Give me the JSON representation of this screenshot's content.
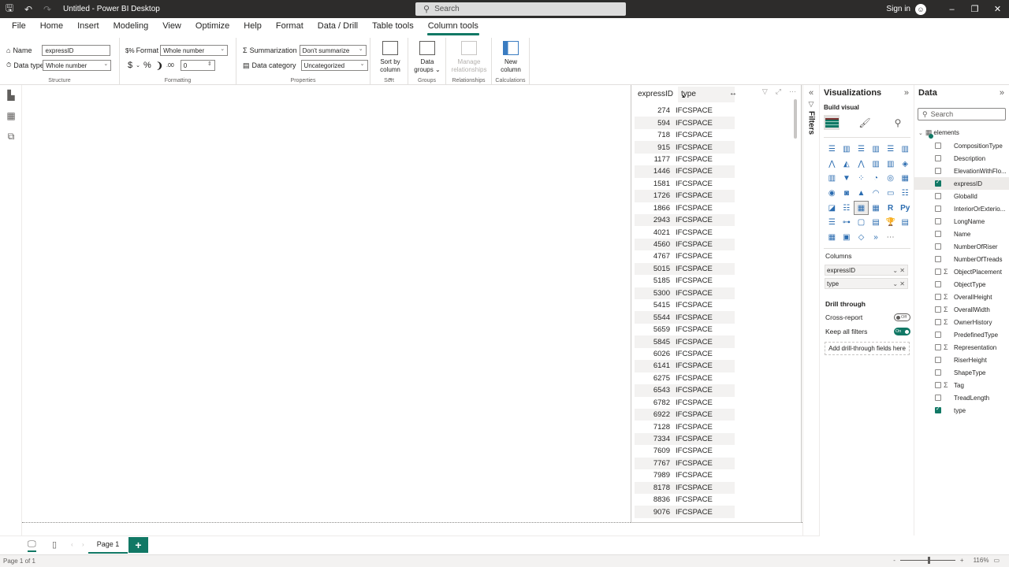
{
  "titlebar": {
    "title": "Untitled - Power BI Desktop",
    "search_placeholder": "Search",
    "sign_in": "Sign in",
    "icons": [
      "save-icon",
      "undo-icon",
      "redo-icon"
    ]
  },
  "menu": {
    "items": [
      "File",
      "Home",
      "Insert",
      "Modeling",
      "View",
      "Optimize",
      "Help",
      "Format",
      "Data / Drill",
      "Table tools",
      "Column tools"
    ],
    "active": "Column tools"
  },
  "ribbon": {
    "structure": {
      "name_label": "Name",
      "name_value": "expressID",
      "datatype_label": "Data type",
      "datatype_value": "Whole number",
      "group_label": "Structure"
    },
    "formatting": {
      "format_label": "Format",
      "format_value": "Whole number",
      "currency_symbol": "$",
      "percent_symbol": "%",
      "comma_symbol": ")",
      "decimals_value": "0",
      "group_label": "Formatting"
    },
    "properties": {
      "summarization_label": "Summarization",
      "summarization_value": "Don't summarize",
      "category_label": "Data category",
      "category_value": "Uncategorized",
      "group_label": "Properties"
    },
    "sort": {
      "label1": "Sort by",
      "label2": "column",
      "group_label": "Sort"
    },
    "groups": {
      "label1": "Data",
      "label2": "groups",
      "group_label": "Groups"
    },
    "relationships": {
      "label1": "Manage",
      "label2": "relationships",
      "group_label": "Relationships"
    },
    "calculations": {
      "label1": "New",
      "label2": "column",
      "group_label": "Calculations"
    }
  },
  "table_visual": {
    "columns": [
      "expressID",
      "type"
    ],
    "sorted_column": "type",
    "rows": [
      [
        "274",
        "IFCSPACE"
      ],
      [
        "594",
        "IFCSPACE"
      ],
      [
        "718",
        "IFCSPACE"
      ],
      [
        "915",
        "IFCSPACE"
      ],
      [
        "1177",
        "IFCSPACE"
      ],
      [
        "1446",
        "IFCSPACE"
      ],
      [
        "1581",
        "IFCSPACE"
      ],
      [
        "1726",
        "IFCSPACE"
      ],
      [
        "1866",
        "IFCSPACE"
      ],
      [
        "2943",
        "IFCSPACE"
      ],
      [
        "4021",
        "IFCSPACE"
      ],
      [
        "4560",
        "IFCSPACE"
      ],
      [
        "4767",
        "IFCSPACE"
      ],
      [
        "5015",
        "IFCSPACE"
      ],
      [
        "5185",
        "IFCSPACE"
      ],
      [
        "5300",
        "IFCSPACE"
      ],
      [
        "5415",
        "IFCSPACE"
      ],
      [
        "5544",
        "IFCSPACE"
      ],
      [
        "5659",
        "IFCSPACE"
      ],
      [
        "5845",
        "IFCSPACE"
      ],
      [
        "6026",
        "IFCSPACE"
      ],
      [
        "6141",
        "IFCSPACE"
      ],
      [
        "6275",
        "IFCSPACE"
      ],
      [
        "6543",
        "IFCSPACE"
      ],
      [
        "6782",
        "IFCSPACE"
      ],
      [
        "6922",
        "IFCSPACE"
      ],
      [
        "7128",
        "IFCSPACE"
      ],
      [
        "7334",
        "IFCSPACE"
      ],
      [
        "7609",
        "IFCSPACE"
      ],
      [
        "7767",
        "IFCSPACE"
      ],
      [
        "7989",
        "IFCSPACE"
      ],
      [
        "8178",
        "IFCSPACE"
      ],
      [
        "8836",
        "IFCSPACE"
      ],
      [
        "9076",
        "IFCSPACE"
      ]
    ]
  },
  "filters": {
    "label": "Filters"
  },
  "visualizations": {
    "title": "Visualizations",
    "build_visual": "Build visual",
    "columns_label": "Columns",
    "fields": [
      "expressID",
      "type"
    ],
    "drill_through": "Drill through",
    "cross_report": "Cross-report",
    "cross_report_state": "Off",
    "keep_filters": "Keep all filters",
    "keep_filters_state": "On",
    "drill_drop": "Add drill-through fields here",
    "more": "···"
  },
  "data_pane": {
    "title": "Data",
    "search_placeholder": "Search",
    "table_name": "elements",
    "fields": [
      {
        "name": "CompositionType",
        "checked": false,
        "sigma": false
      },
      {
        "name": "Description",
        "checked": false,
        "sigma": false
      },
      {
        "name": "ElevationWithFlo...",
        "checked": false,
        "sigma": false
      },
      {
        "name": "expressID",
        "checked": true,
        "sigma": false
      },
      {
        "name": "GlobalId",
        "checked": false,
        "sigma": false
      },
      {
        "name": "InteriorOrExterio...",
        "checked": false,
        "sigma": false
      },
      {
        "name": "LongName",
        "checked": false,
        "sigma": false
      },
      {
        "name": "Name",
        "checked": false,
        "sigma": false
      },
      {
        "name": "NumberOfRiser",
        "checked": false,
        "sigma": false
      },
      {
        "name": "NumberOfTreads",
        "checked": false,
        "sigma": false
      },
      {
        "name": "ObjectPlacement",
        "checked": false,
        "sigma": true
      },
      {
        "name": "ObjectType",
        "checked": false,
        "sigma": false
      },
      {
        "name": "OverallHeight",
        "checked": false,
        "sigma": true
      },
      {
        "name": "OverallWidth",
        "checked": false,
        "sigma": true
      },
      {
        "name": "OwnerHistory",
        "checked": false,
        "sigma": true
      },
      {
        "name": "PredefinedType",
        "checked": false,
        "sigma": false
      },
      {
        "name": "Representation",
        "checked": false,
        "sigma": true
      },
      {
        "name": "RiserHeight",
        "checked": false,
        "sigma": false
      },
      {
        "name": "ShapeType",
        "checked": false,
        "sigma": false
      },
      {
        "name": "Tag",
        "checked": false,
        "sigma": true
      },
      {
        "name": "TreadLength",
        "checked": false,
        "sigma": false
      },
      {
        "name": "type",
        "checked": true,
        "sigma": false
      }
    ]
  },
  "pages": {
    "tabs": [
      "Page 1"
    ],
    "add": "+"
  },
  "status": {
    "page_info": "Page 1 of 1",
    "zoom": "116%",
    "zoom_level_percent": 116,
    "zoom_minus": "-",
    "zoom_plus": "+"
  },
  "colors": {
    "accent": "#117865",
    "titlebar": "#2d2c2b"
  }
}
